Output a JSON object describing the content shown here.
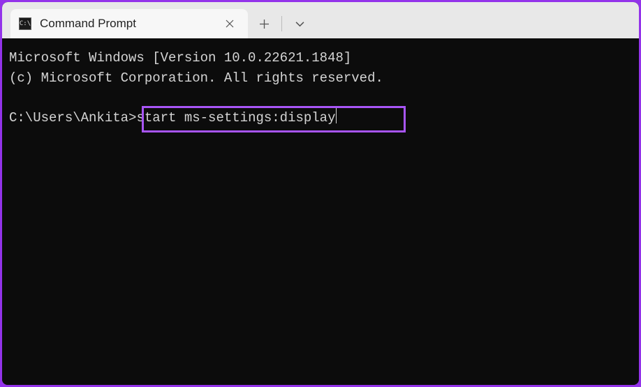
{
  "tab": {
    "title": "Command Prompt"
  },
  "terminal": {
    "line1": "Microsoft Windows [Version 10.0.22621.1848]",
    "line2": "(c) Microsoft Corporation. All rights reserved.",
    "prompt": "C:\\Users\\Ankita>",
    "command": "start ms-settings:display"
  }
}
